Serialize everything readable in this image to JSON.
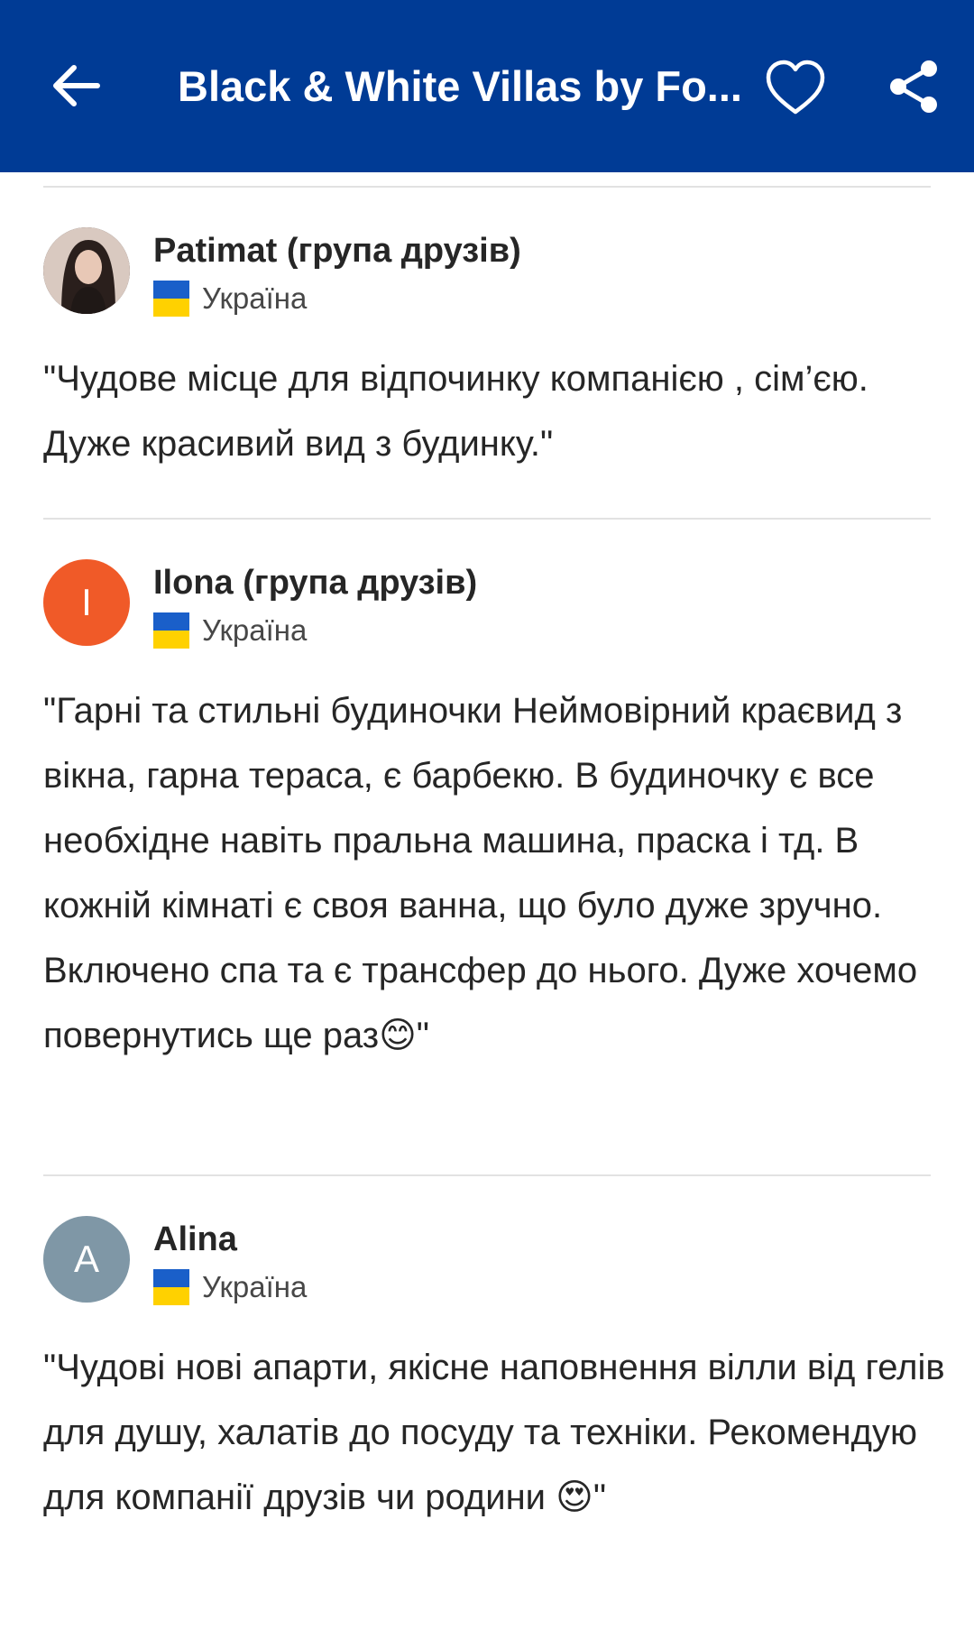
{
  "header": {
    "back_icon": "arrow-left-icon",
    "title": "Black & White Villas by Fo...",
    "favorite_icon": "heart-outline-icon",
    "share_icon": "share-icon",
    "background_color": "#003b95"
  },
  "reviews": [
    {
      "name": "Patimat (група друзів)",
      "country": "Україна",
      "avatar_type": "photo",
      "text": "\"Чудове місце для відпочинку компанією , сім’єю. Дуже красивий вид з будинку.\""
    },
    {
      "name": "Ilona (група друзів)",
      "country": "Україна",
      "avatar_letter": "I",
      "avatar_color": "#f05a28",
      "text": "\"Гарні та стильні будиночки Неймовірний краєвид з вікна, гарна тераса, є барбекю. В будиночку є все необхідне навіть пральна машина, праска і тд. В кожній кімнаті є своя ванна, що було дуже зручно. Включено спа та є трансфер до нього. Дуже хочемо повернутись ще раз😊\""
    },
    {
      "name": "Alina",
      "country": "Україна",
      "avatar_letter": "A",
      "avatar_color": "#7f97a6",
      "text": "\"Чудові нові апарти, якісне наповнення вілли від гелів для душу, халатів до посуду та техніки. Рекомендую для компанії друзів чи родини 😍\""
    }
  ]
}
